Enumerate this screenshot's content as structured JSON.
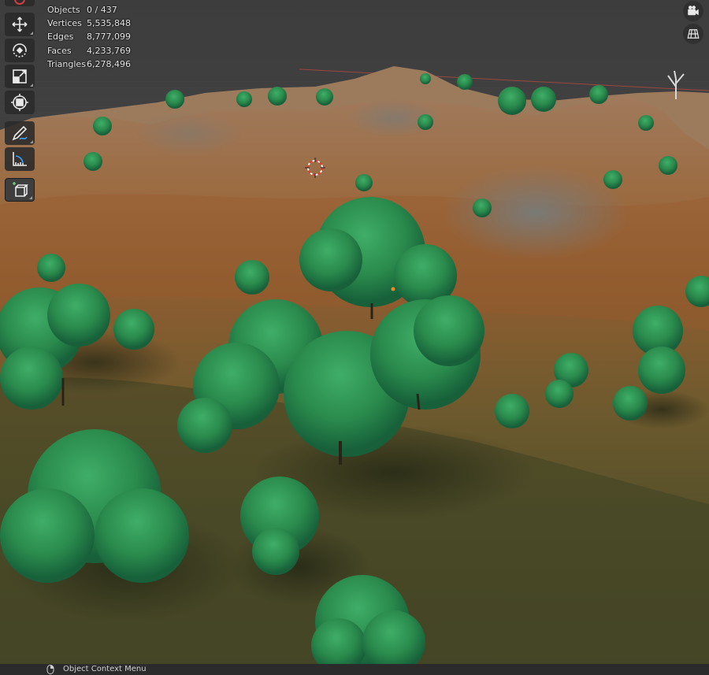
{
  "stats": [
    {
      "name": "Objects",
      "value": "0 / 437"
    },
    {
      "name": "Vertices",
      "value": "5,535,848"
    },
    {
      "name": "Edges",
      "value": "8,777,099"
    },
    {
      "name": "Faces",
      "value": "4,233,769"
    },
    {
      "name": "Triangles",
      "value": "6,278,496"
    }
  ],
  "toolbar": {
    "tools": [
      "move-icon",
      "rotate-icon",
      "scale-icon",
      "transform-icon",
      "annotate-icon",
      "measure-icon",
      "add-cube-icon"
    ],
    "active_tool": "add-cube-icon"
  },
  "gizmos": [
    "camera-icon",
    "grid-view-icon"
  ],
  "statusbar": {
    "label": "Object Context Menu",
    "icon": "mouse-right-icon"
  },
  "colors": {
    "tree_green": "#2a8a4c",
    "terrain_brown": "#8a5a34",
    "background": "#3d3d3d",
    "cursor_red": "#d23a2a"
  }
}
